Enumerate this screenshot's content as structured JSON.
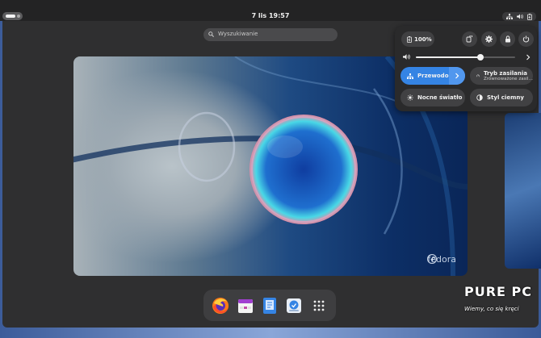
{
  "topbar": {
    "clock": "7 lis  19:57",
    "tray_icons": [
      "network-icon",
      "volume-icon",
      "battery-icon"
    ]
  },
  "search": {
    "placeholder": "Wyszukiwanie"
  },
  "workspace": {
    "brand": "fedora"
  },
  "quick_settings": {
    "battery_label": "100%",
    "volume_percent": 65,
    "buttons": [
      "screenshot-lock-icon",
      "settings-icon",
      "lock-icon",
      "power-icon"
    ],
    "tiles": {
      "network": {
        "label": "Przewodo…",
        "active": true
      },
      "power_mode": {
        "label": "Tryb zasilania",
        "sublabel": "Zrównoważone zasil…"
      },
      "night_light": {
        "label": "Nocne światło"
      },
      "dark_style": {
        "label": "Styl ciemny"
      }
    }
  },
  "dash": {
    "apps": [
      "firefox-icon",
      "calendar-icon",
      "text-editor-icon",
      "software-icon",
      "app-grid-icon"
    ]
  },
  "watermark": {
    "title": "PURE PC",
    "tagline": "Wiemy, co się kręci"
  },
  "colors": {
    "accent": "#3584e4",
    "panel": "#2a2a2b",
    "tile": "#414143"
  }
}
